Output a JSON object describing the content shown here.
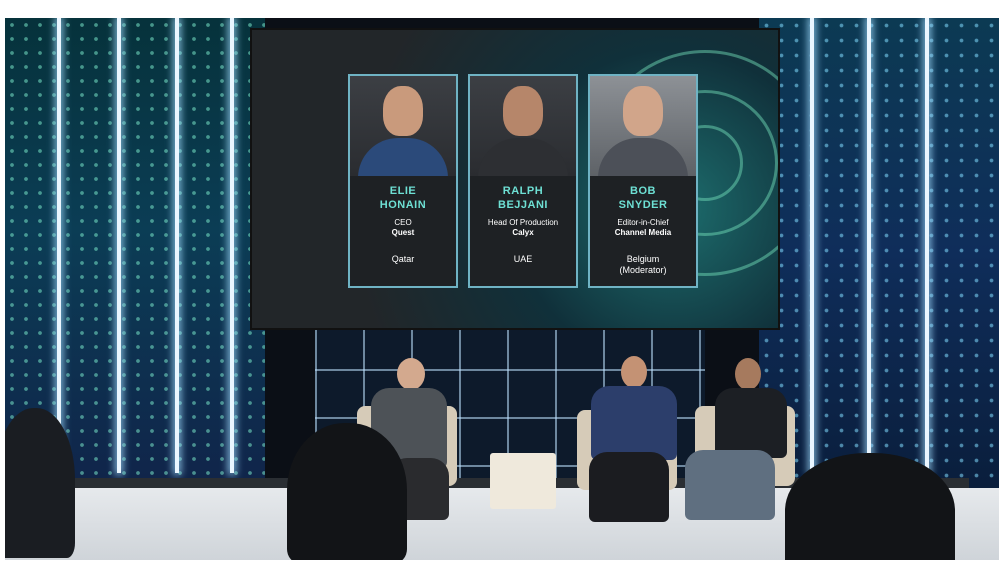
{
  "screen": {
    "speakers": [
      {
        "name_line1": "ELIE",
        "name_line2": "HONAIN",
        "title": "CEO",
        "organization": "Quest",
        "country": "Qatar",
        "country_line2": ""
      },
      {
        "name_line1": "RALPH",
        "name_line2": "BEJJANI",
        "title": "Head Of Production",
        "organization": "Calyx",
        "country": "UAE",
        "country_line2": ""
      },
      {
        "name_line1": "BOB",
        "name_line2": "SNYDER",
        "title": "Editor-in-Chief",
        "organization": "Channel Media",
        "country": "Belgium",
        "country_line2": "(Moderator)"
      }
    ]
  },
  "colors": {
    "accent_teal": "#6ee0d4",
    "card_border": "#6fb3c4",
    "card_bg": "#1e2124"
  }
}
